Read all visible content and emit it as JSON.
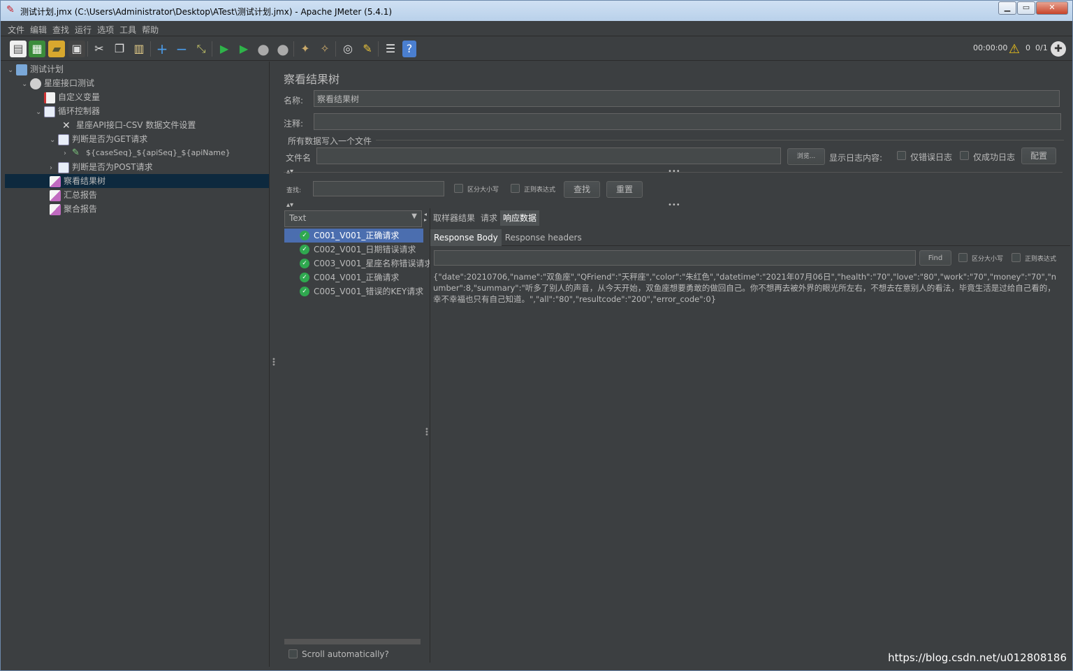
{
  "window": {
    "title": "测试计划.jmx (C:\\Users\\Administrator\\Desktop\\ATest\\测试计划.jmx) - Apache JMeter (5.4.1)"
  },
  "menu": [
    "文件",
    "编辑",
    "查找",
    "运行",
    "选项",
    "工具",
    "帮助"
  ],
  "toolbar_icons": [
    "new-icon",
    "templates-icon",
    "open-icon",
    "save-icon",
    "cut-icon",
    "copy-icon",
    "paste-icon",
    "expand-icon",
    "collapse-icon",
    "toggle-icon",
    "start-icon",
    "start-no-pause-icon",
    "stop-icon",
    "shutdown-icon",
    "clear-icon",
    "clear-all-icon",
    "search-icon",
    "reset-search-icon",
    "function-helper-icon",
    "help-icon"
  ],
  "status": {
    "timer": "00:00:00",
    "warnings": "0",
    "threads": "0/1"
  },
  "tree": [
    {
      "label": "测试计划",
      "icon": "test-plan-icon"
    },
    {
      "label": "星座接口测试",
      "icon": "thread-group-icon"
    },
    {
      "label": "自定义变量",
      "icon": "config-icon"
    },
    {
      "label": "循环控制器",
      "icon": "controller-icon"
    },
    {
      "label": "星座API接口-CSV 数据文件设置",
      "icon": "csv-config-icon"
    },
    {
      "label": "判断是否为GET请求",
      "icon": "if-controller-icon"
    },
    {
      "label": "${caseSeq}_${apiSeq}_${apiName}",
      "icon": "http-sampler-icon"
    },
    {
      "label": "判断是否为POST请求",
      "icon": "if-controller-icon"
    },
    {
      "label": "察看结果树",
      "icon": "listener-icon"
    },
    {
      "label": "汇总报告",
      "icon": "listener-icon"
    },
    {
      "label": "聚合报告",
      "icon": "listener-icon"
    }
  ],
  "panel": {
    "title": "察看结果树",
    "name_label": "名称:",
    "name_value": "察看结果树",
    "comment_label": "注释:",
    "comment_value": "",
    "file_group_label": "所有数据写入一个文件",
    "filename_label": "文件名",
    "filename_value": "",
    "browse_button": "浏览...",
    "log_display_label": "显示日志内容:",
    "errors_only_label": "仅错误日志",
    "success_only_label": "仅成功日志",
    "configure_button": "配置",
    "search_label": "查找:",
    "search_value": "",
    "case_sensitive_label": "区分大小写",
    "regex_label": "正则表达式",
    "search_button": "查找",
    "reset_button": "重置",
    "renderer_selected": "Text",
    "scroll_auto_label": "Scroll automatically?"
  },
  "results": [
    "C001_V001_正确请求",
    "C002_V001_日期错误请求",
    "C003_V001_星座名称错误请求",
    "C004_V001_正确请求",
    "C005_V001_错误的KEY请求"
  ],
  "tabs": [
    "取样器结果",
    "请求",
    "响应数据"
  ],
  "subtabs": [
    "Response Body",
    "Response headers"
  ],
  "find": {
    "value": "",
    "button": "Find",
    "case_label": "区分大小写",
    "regex_label": "正则表达式"
  },
  "response_body": "{\"date\":20210706,\"name\":\"双鱼座\",\"QFriend\":\"天秤座\",\"color\":\"朱红色\",\"datetime\":\"2021年07月06日\",\"health\":\"70\",\"love\":\"80\",\"work\":\"70\",\"money\":\"70\",\"number\":8,\"summary\":\"听多了别人的声音，从今天开始，双鱼座想要勇敢的做回自己。你不想再去被外界的眼光所左右，不想去在意别人的看法，毕竟生活是过给自己看的，幸不幸福也只有自己知道。\",\"all\":\"80\",\"resultcode\":\"200\",\"error_code\":0}",
  "watermark": "https://blog.csdn.net/u012808186",
  "colors": {
    "background": "#3c3f41",
    "selection": "#4b6eaf",
    "tree_selection": "#0d293e",
    "success": "#2fa84f"
  }
}
